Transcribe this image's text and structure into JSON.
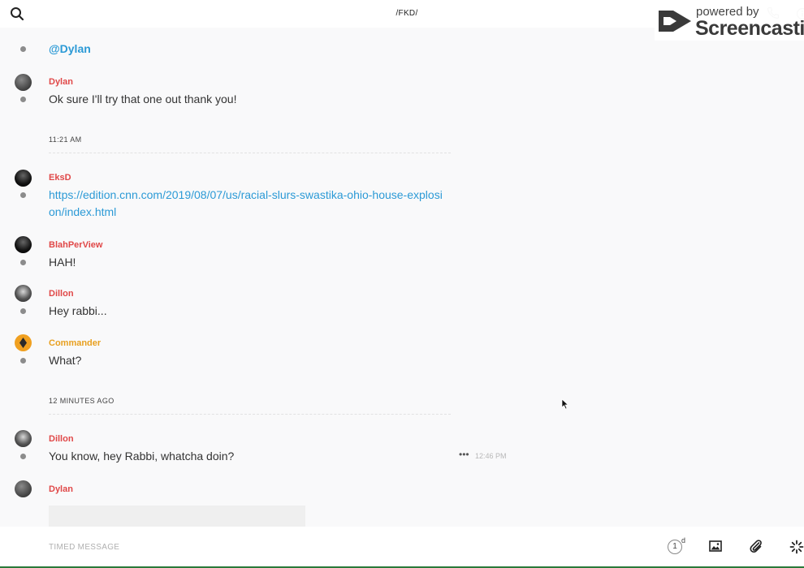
{
  "header": {
    "channel": "/FKD/",
    "watermark": {
      "small": "powered by",
      "big": "Screencastify"
    }
  },
  "messages": [
    {
      "text": "@Dylan"
    },
    {
      "author": "Dylan",
      "text": "Ok sure I'll try that one out thank you!"
    },
    {
      "author": "EksD",
      "text": "https://edition.cnn.com/2019/08/07/us/racial-slurs-swastika-ohio-house-explosion/index.html"
    },
    {
      "author": "BlahPerView",
      "text": "HAH!"
    },
    {
      "author": "Dillon",
      "text": "Hey rabbi..."
    },
    {
      "author": "Commander",
      "text": "What?"
    },
    {
      "author": "Dillon",
      "text": "You know, hey Rabbi, whatcha doin?",
      "time": "12:46 PM",
      "more": "•••"
    },
    {
      "author": "Dylan"
    }
  ],
  "dividers": [
    "11:21 AM",
    "12 MINUTES AGO"
  ],
  "composer": {
    "placeholder": "TIMED MESSAGE",
    "timer_value": "1",
    "timer_unit": "d"
  },
  "colors": {
    "author": "#e04848",
    "author_commander": "#e8a020",
    "link": "#2c9ad6",
    "bottom_border": "#2a7a3a"
  },
  "icons": {
    "search": "search-icon",
    "call": "phone-icon",
    "info": "info-icon",
    "image": "image-icon",
    "attach": "paperclip-icon",
    "loading": "spinner-icon"
  }
}
